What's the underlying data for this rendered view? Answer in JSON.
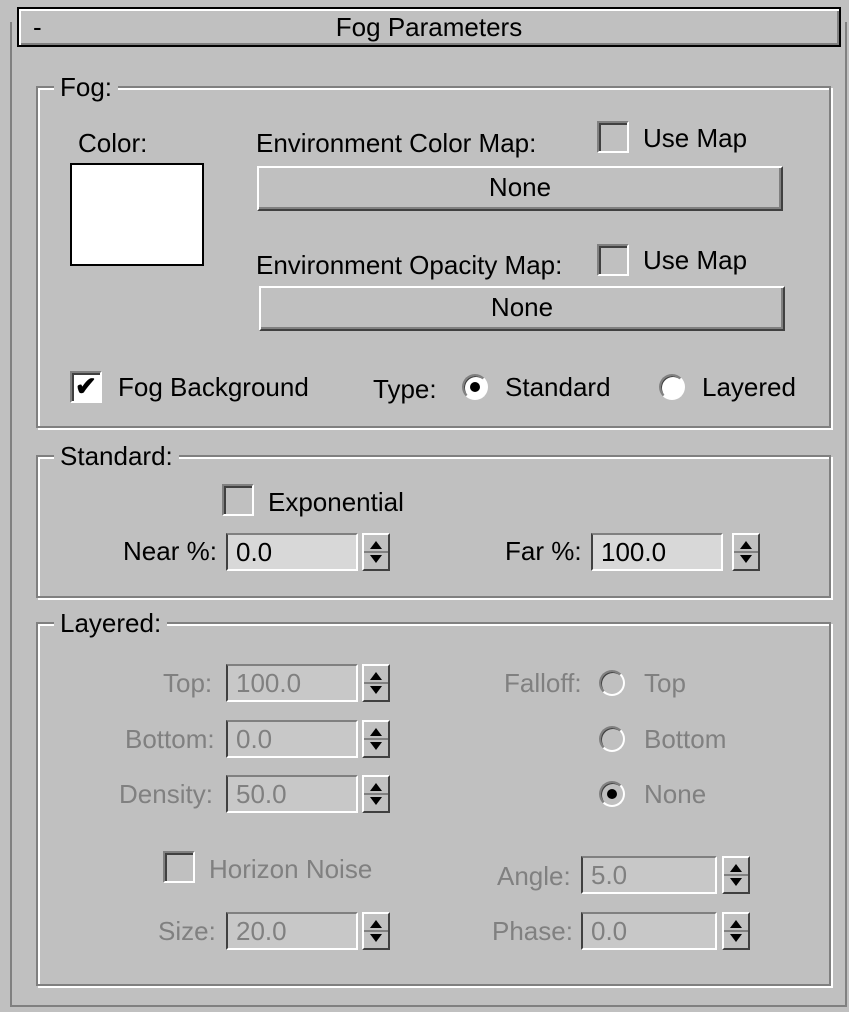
{
  "rollout": {
    "title": "Fog Parameters",
    "collapse_symbol": "-"
  },
  "fog": {
    "group_title": "Fog:",
    "color_label": "Color:",
    "color_value": "#ffffff",
    "env_color_map_label": "Environment Color Map:",
    "env_color_use_map_label": "Use Map",
    "env_color_use_map_checked": false,
    "env_color_map_button": "None",
    "env_opacity_map_label": "Environment Opacity Map:",
    "env_opacity_use_map_label": "Use Map",
    "env_opacity_use_map_checked": false,
    "env_opacity_map_button": "None",
    "fog_background_label": "Fog Background",
    "fog_background_checked": true,
    "type_label": "Type:",
    "type_options": [
      "Standard",
      "Layered"
    ],
    "type_selected": "Standard"
  },
  "standard": {
    "group_title": "Standard:",
    "exponential_label": "Exponential",
    "exponential_checked": false,
    "near_label": "Near %:",
    "near_value": "0.0",
    "far_label": "Far %:",
    "far_value": "100.0"
  },
  "layered": {
    "group_title": "Layered:",
    "top_label": "Top:",
    "top_value": "100.0",
    "bottom_label": "Bottom:",
    "bottom_value": "0.0",
    "density_label": "Density:",
    "density_value": "50.0",
    "falloff_label": "Falloff:",
    "falloff_options": [
      "Top",
      "Bottom",
      "None"
    ],
    "falloff_selected": "None",
    "horizon_noise_label": "Horizon Noise",
    "horizon_noise_checked": false,
    "size_label": "Size:",
    "size_value": "20.0",
    "angle_label": "Angle:",
    "angle_value": "5.0",
    "phase_label": "Phase:",
    "phase_value": "0.0"
  },
  "icons": {
    "check_mark": "✔",
    "spinner": "spinner-arrows-icon"
  }
}
